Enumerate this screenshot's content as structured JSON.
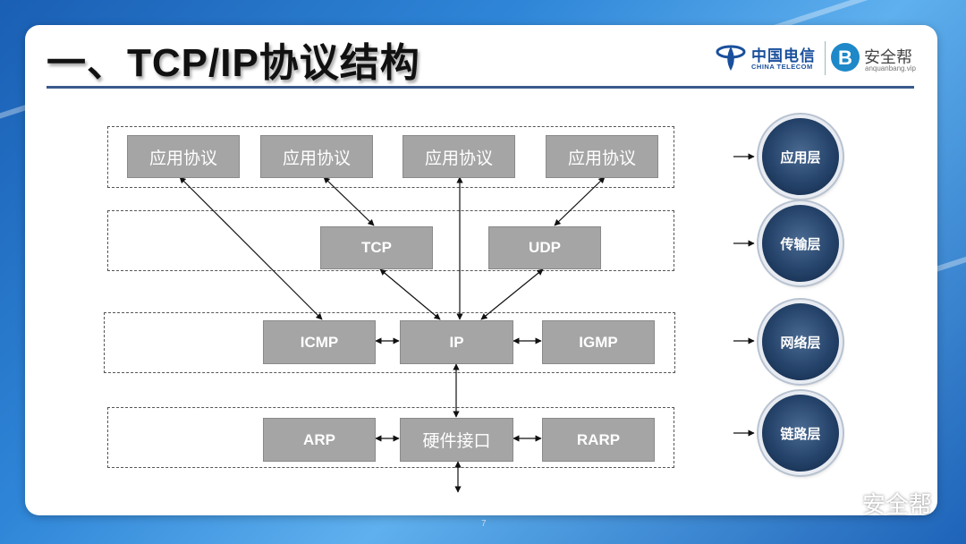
{
  "slide": {
    "title": "一、TCP/IP协议结构",
    "page_number": "7"
  },
  "logos": {
    "china_telecom_cn": "中国电信",
    "china_telecom_en": "CHINA TELECOM",
    "anquanbang_name": "安全帮",
    "anquanbang_url": "anquanbang.vip"
  },
  "diagram": {
    "application_boxes": [
      "应用协议",
      "应用协议",
      "应用协议",
      "应用协议"
    ],
    "transport_boxes": [
      "TCP",
      "UDP"
    ],
    "network_boxes": [
      "ICMP",
      "IP",
      "IGMP"
    ],
    "link_boxes": [
      "ARP",
      "硬件接口",
      "RARP"
    ]
  },
  "layers": {
    "application": "应用层",
    "transport": "传输层",
    "network": "网络层",
    "link": "链路层"
  },
  "watermark": {
    "text": "安全帮"
  },
  "colors": {
    "box_fill": "#a5a5a5",
    "badge": "#25436a",
    "title_rule": "#3a5a8c",
    "background": "#2f86d8"
  }
}
